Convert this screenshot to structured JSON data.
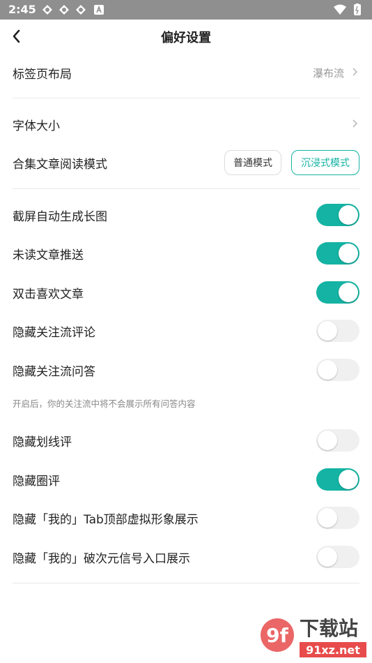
{
  "status_bar": {
    "time": "2:45",
    "icons": [
      "app-notification-icon",
      "app-notification-icon",
      "app-notification-icon",
      "a-badge-icon",
      "wifi-icon",
      "battery-icon"
    ]
  },
  "header": {
    "title": "偏好设置",
    "back_icon": "chevron-left-icon"
  },
  "tab_layout": {
    "label": "标签页布局",
    "value": "瀑布流"
  },
  "font_size": {
    "label": "字体大小"
  },
  "reading_mode": {
    "label": "合集文章阅读模式",
    "options": [
      "普通模式",
      "沉浸式模式"
    ],
    "selected": "沉浸式模式"
  },
  "toggles": [
    {
      "label": "截屏自动生成长图",
      "on": true
    },
    {
      "label": "未读文章推送",
      "on": true
    },
    {
      "label": "双击喜欢文章",
      "on": true
    },
    {
      "label": "隐藏关注流评论",
      "on": false
    },
    {
      "label": "隐藏关注流问答",
      "on": false
    }
  ],
  "hint": "开启后，你的关注流中将不会展示所有问答内容",
  "toggles2": [
    {
      "label": "隐藏划线评",
      "on": false
    },
    {
      "label": "隐藏圈评",
      "on": true
    },
    {
      "label": "隐藏「我的」Tab顶部虚拟形象展示",
      "on": false
    },
    {
      "label": "隐藏「我的」破次元信号入口展示",
      "on": false
    }
  ],
  "watermark": {
    "brand": "下载站",
    "site": "91xz.net"
  },
  "colors": {
    "accent": "#14b3a3",
    "status_bar": "#8f8f8f",
    "toggle_off": "#f0f0f0"
  }
}
